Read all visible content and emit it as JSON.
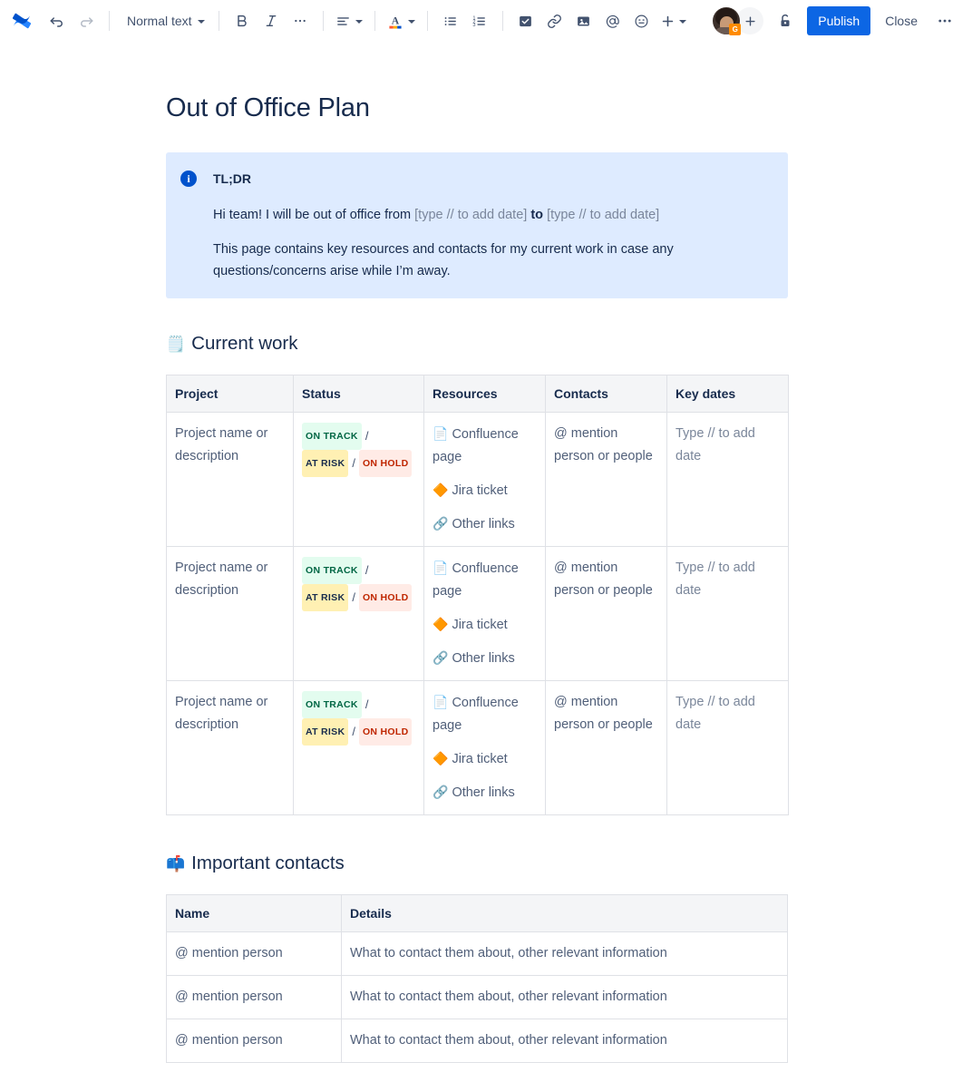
{
  "app": {
    "logo_icon": "confluence-logo-icon",
    "window_kind": "confluence-page-editor"
  },
  "toolbar": {
    "undo_label": "Undo",
    "undo_icon": "undo-arrow-icon",
    "redo_label": "Redo",
    "redo_icon": "redo-arrow-icon",
    "text_style": "Normal text",
    "bold_label": "B",
    "italic_label": "I",
    "more_formatting_label": "…",
    "align_icon": "text-align-left-icon",
    "text_color_icon": "text-color-icon",
    "bullet_list_icon": "bullet-list-icon",
    "numbered_list_icon": "numbered-list-icon",
    "task_icon": "task-checkbox-icon",
    "link_icon": "link-icon",
    "image_icon": "image-icon",
    "mention_icon": "mention-at-icon",
    "emoji_icon": "emoji-smiley-icon",
    "insert_icon": "plus-insert-icon",
    "avatar_badge": "G",
    "add_people_icon": "plus-icon",
    "restrictions_icon": "unlock-padlock-icon",
    "publish_label": "Publish",
    "close_label": "Close",
    "more_options_label": "…",
    "accent_color": "#0C66E4"
  },
  "document": {
    "title": "Out of Office Plan",
    "info_panel": {
      "icon": "info-circle-icon",
      "title": "TL;DR",
      "paragraph_1_prefix": "Hi team! I will be out of office from ",
      "date_placeholder_1": "[type // to add date]",
      "paragraph_1_middle": " to ",
      "date_placeholder_2": "[type // to add date]",
      "paragraph_2": "This page contains key resources and contacts for my current work in case any questions/concerns arise while I’m away.",
      "background_color": "#DEEBFF"
    },
    "sections": [
      {
        "emoji": "🗒️",
        "emoji_name": "spiral-notepad-emoji",
        "heading": "Current work"
      },
      {
        "emoji": "📫",
        "emoji_name": "mailbox-emoji",
        "heading": "Important contacts"
      }
    ],
    "current_work_table": {
      "columns": [
        "Project",
        "Status",
        "Resources",
        "Contacts",
        "Key dates"
      ],
      "rows": [
        {
          "project": "Project name or description",
          "status": [
            "ON TRACK",
            "AT RISK",
            "ON HOLD"
          ],
          "status_separator": "/",
          "resources": [
            {
              "emoji": "📄",
              "emoji_name": "page-document-emoji",
              "label": "Confluence page"
            },
            {
              "emoji": "🔶",
              "emoji_name": "jira-ticket-emoji",
              "label": "Jira ticket"
            },
            {
              "emoji": "🔗",
              "emoji_name": "link-chain-emoji",
              "label": "Other links"
            }
          ],
          "contacts": "@ mention person or people",
          "key_dates": "Type // to add date"
        },
        {
          "project": "Project name or description",
          "status": [
            "ON TRACK",
            "AT RISK",
            "ON HOLD"
          ],
          "status_separator": "/",
          "resources": [
            {
              "emoji": "📄",
              "emoji_name": "page-document-emoji",
              "label": "Confluence page"
            },
            {
              "emoji": "🔶",
              "emoji_name": "jira-ticket-emoji",
              "label": "Jira ticket"
            },
            {
              "emoji": "🔗",
              "emoji_name": "link-chain-emoji",
              "label": "Other links"
            }
          ],
          "contacts": "@ mention person or people",
          "key_dates": "Type // to add date"
        },
        {
          "project": "Project name or description",
          "status": [
            "ON TRACK",
            "AT RISK",
            "ON HOLD"
          ],
          "status_separator": "/",
          "resources": [
            {
              "emoji": "📄",
              "emoji_name": "page-document-emoji",
              "label": "Confluence page"
            },
            {
              "emoji": "🔶",
              "emoji_name": "jira-ticket-emoji",
              "label": "Jira ticket"
            },
            {
              "emoji": "🔗",
              "emoji_name": "link-chain-emoji",
              "label": "Other links"
            }
          ],
          "contacts": "@ mention person or people",
          "key_dates": "Type // to add date"
        }
      ],
      "status_colors": {
        "on_track_bg": "#E3FCEF",
        "on_track_fg": "#006644",
        "at_risk_bg": "#FFF0B3",
        "at_risk_fg": "#172B4D",
        "on_hold_bg": "#FFEBE6",
        "on_hold_fg": "#BF2600"
      }
    },
    "contacts_table": {
      "columns": [
        "Name",
        "Details"
      ],
      "rows": [
        {
          "name": "@ mention person",
          "details": "What to contact them about, other relevant information"
        },
        {
          "name": "@ mention person",
          "details": "What to contact them about, other relevant information"
        },
        {
          "name": "@ mention person",
          "details": "What to contact them about, other relevant information"
        }
      ]
    }
  }
}
